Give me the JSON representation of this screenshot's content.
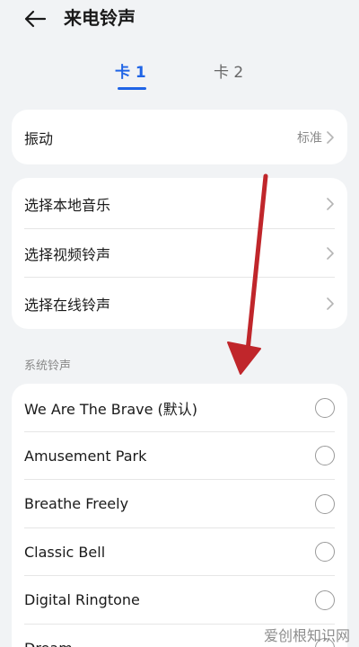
{
  "header": {
    "title": "来电铃声"
  },
  "tabs": [
    {
      "label": "卡 1",
      "active": true
    },
    {
      "label": "卡 2",
      "active": false
    }
  ],
  "vibration": {
    "label": "振动",
    "value": "标准"
  },
  "sources": [
    {
      "label": "选择本地音乐"
    },
    {
      "label": "选择视频铃声"
    },
    {
      "label": "选择在线铃声"
    }
  ],
  "section_label": "系统铃声",
  "ringtones": [
    {
      "label": "We Are The Brave (默认)",
      "selected": false
    },
    {
      "label": "Amusement Park",
      "selected": false
    },
    {
      "label": "Breathe Freely",
      "selected": false
    },
    {
      "label": "Classic Bell",
      "selected": false
    },
    {
      "label": "Digital Ringtone",
      "selected": false
    },
    {
      "label": "Dream",
      "selected": false
    }
  ],
  "watermark": "爱创根知识网",
  "colors": {
    "accent": "#1f64e6",
    "annotation_arrow": "#c0262b",
    "background": "#f1f3f5"
  }
}
